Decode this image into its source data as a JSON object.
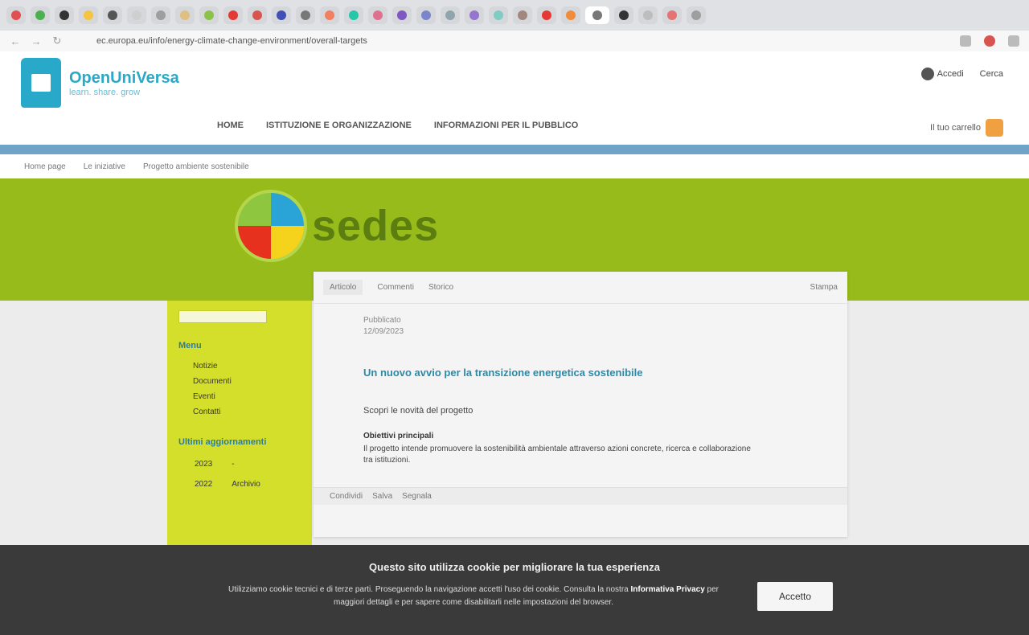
{
  "browser": {
    "tab_colors": [
      "#e15050",
      "#4caf50",
      "#333333",
      "#f5c542",
      "#555555",
      "#cfcfcf",
      "#9e9e9e",
      "#e0c080",
      "#8bc34a",
      "#e53935",
      "#d9534f",
      "#3f51b5",
      "#777777",
      "#f08060",
      "#26c6a8",
      "#e07090",
      "#7e57c2",
      "#7986cb",
      "#90a4ae",
      "#9575cd",
      "#80cbc4",
      "#a1887f",
      "#e53935",
      "#f08c3a",
      "#777777",
      "#333333",
      "#bdbdbd",
      "#e57373",
      "#9e9e9e"
    ],
    "url": "ec.europa.eu/info/energy-climate-change-environment/overall-targets"
  },
  "site": {
    "logo_title": "OpenUniVersa",
    "logo_subtitle": "learn. share. grow",
    "header_links": [
      "Accedi",
      "Cerca"
    ],
    "nav": [
      "HOME",
      "ISTITUZIONE E ORGANIZZAZIONE",
      "INFORMAZIONI PER IL PUBBLICO"
    ],
    "cart_label": "Il tuo carrello",
    "breadcrumb": [
      "Home page",
      "Le iniziative",
      "Progetto ambiente sostenibile"
    ]
  },
  "banner": {
    "word": "sedes"
  },
  "sidebar": {
    "heading": "Menu",
    "items": [
      "Notizie",
      "Documenti",
      "Eventi",
      "Contatti"
    ],
    "heading2": "Ultimi aggiornamenti",
    "rows": [
      {
        "a": "2023",
        "b": "-"
      },
      {
        "a": "2022",
        "b": "Archivio"
      }
    ]
  },
  "card": {
    "tabs": [
      "Articolo",
      "Commenti",
      "Storico"
    ],
    "tab_right": "Stampa",
    "meta_line1": "Pubblicato",
    "meta_line2": "12/09/2023",
    "title": "Un nuovo avvio per la transizione energetica sostenibile",
    "lead": "Scopri le novità del progetto",
    "subheading": "Obiettivi principali",
    "body": "Il progetto intende promuovere la sostenibilità ambientale attraverso azioni concrete, ricerca e collaborazione tra istituzioni.",
    "footer": [
      "Condividi",
      "Salva",
      "Segnala"
    ]
  },
  "cookie": {
    "title": "Questo sito utilizza cookie per migliorare la tua esperienza",
    "text_before": "Utilizziamo cookie tecnici e di terze parti. Proseguendo la navigazione accetti l'uso dei cookie. Consulta la nostra ",
    "link": "Informativa Privacy",
    "text_after": " per maggiori dettagli e per sapere come disabilitarli nelle impostazioni del browser.",
    "button": "Accetto"
  }
}
